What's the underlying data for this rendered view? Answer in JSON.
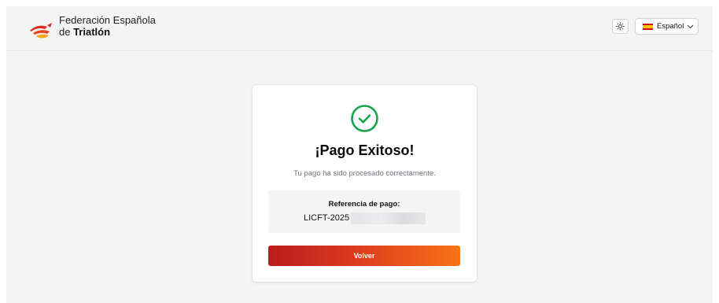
{
  "header": {
    "brand_line1": "Federación Española",
    "brand_line2_prefix": "de ",
    "brand_line2_bold": "Triatlón",
    "theme_toggle_icon": "sun-icon",
    "language": {
      "label": "Español",
      "flag": "spain-flag-icon",
      "chevron": "chevron-down-icon"
    }
  },
  "card": {
    "status_icon": "check-circle-icon",
    "title": "¡Pago Exitoso!",
    "subtitle": "Tu pago ha sido procesado correctamente.",
    "reference_label": "Referencia de pago:",
    "reference_value": "LICFT-2025",
    "button_label": "Volver"
  },
  "colors": {
    "success": "#16a34a",
    "button_gradient_start": "#b91c1c",
    "button_gradient_end": "#f97316",
    "background": "#f4f4f5"
  }
}
